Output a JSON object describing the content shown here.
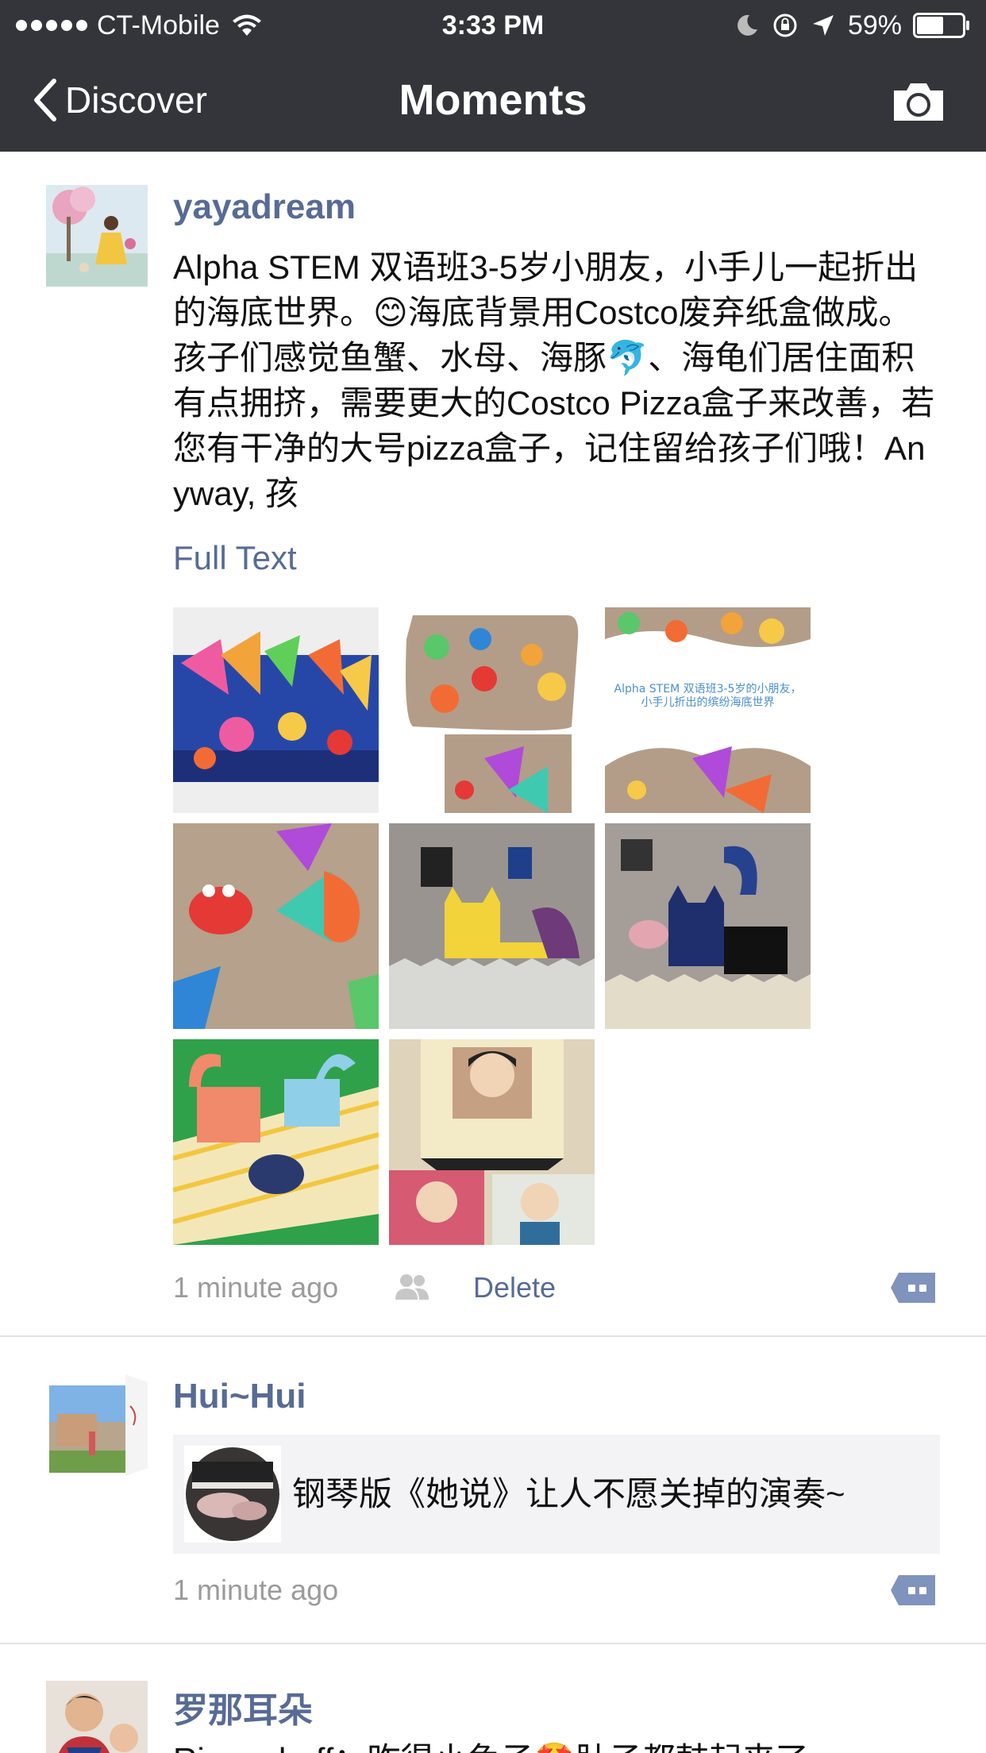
{
  "status_bar": {
    "carrier": "CT-Mobile",
    "time": "3:33 PM",
    "battery": "59%",
    "battery_level": 0.59
  },
  "nav": {
    "back_label": "Discover",
    "title": "Moments"
  },
  "posts": [
    {
      "username": "yayadream",
      "text": "Alpha STEM 双语班3-5岁小朋友，小手儿一起折出的海底世界。😊海底背景用Costco废弃纸盒做成。孩子们感觉鱼蟹、水母、海豚🐬、海龟们居住面积有点拥挤，需要更大的Costco Pizza盒子来改善，若您有干净的大号pizza盒子，记住留给孩子们哦！Anyway, 孩",
      "full_text_label": "Full Text",
      "photo_count": 8,
      "photo_caption": "Alpha STEM 双语班3-5岁的小朋友，小手儿折出的缤纷海底世界",
      "time": "1 minute ago",
      "delete_label": "Delete"
    },
    {
      "username": "Hui~Hui",
      "share_title": "钢琴版《她说》让人不愿关掉的演奏~",
      "time": "1 minute ago"
    },
    {
      "username": "罗那耳朵",
      "text": "Rigor cboff：昨得小兔子🤩肚子都鼓起来了"
    }
  ],
  "colors": {
    "bar_bg": "#34353a",
    "link": "#586b95",
    "meta": "#9b9b9b",
    "divider": "#e2e2e2",
    "card_bg": "#f3f3f5"
  }
}
